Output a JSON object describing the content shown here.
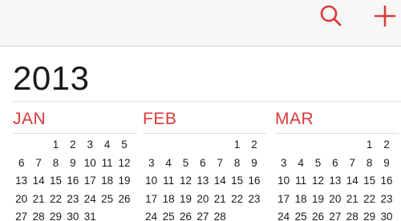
{
  "toolbar": {
    "icons": [
      "search-icon",
      "add-icon"
    ],
    "accent_color": "#d93a3a"
  },
  "year": "2013",
  "months": [
    {
      "name": "JAN",
      "weeks": [
        [
          "",
          "",
          "1",
          "2",
          "3",
          "4",
          "5"
        ],
        [
          "6",
          "7",
          "8",
          "9",
          "10",
          "11",
          "12"
        ],
        [
          "13",
          "14",
          "15",
          "16",
          "17",
          "18",
          "19"
        ],
        [
          "20",
          "21",
          "22",
          "23",
          "24",
          "25",
          "26"
        ],
        [
          "27",
          "28",
          "29",
          "30",
          "31",
          "",
          ""
        ]
      ]
    },
    {
      "name": "FEB",
      "weeks": [
        [
          "",
          "",
          "",
          "",
          "",
          "1",
          "2"
        ],
        [
          "3",
          "4",
          "5",
          "6",
          "7",
          "8",
          "9"
        ],
        [
          "10",
          "11",
          "12",
          "13",
          "14",
          "15",
          "16"
        ],
        [
          "17",
          "18",
          "19",
          "20",
          "21",
          "22",
          "23"
        ],
        [
          "24",
          "25",
          "26",
          "27",
          "28",
          "",
          ""
        ]
      ]
    },
    {
      "name": "MAR",
      "weeks": [
        [
          "",
          "",
          "",
          "",
          "",
          "1",
          "2"
        ],
        [
          "3",
          "4",
          "5",
          "6",
          "7",
          "8",
          "9"
        ],
        [
          "10",
          "11",
          "12",
          "13",
          "14",
          "15",
          "16"
        ],
        [
          "17",
          "18",
          "19",
          "20",
          "21",
          "22",
          "23"
        ],
        [
          "24",
          "25",
          "26",
          "27",
          "28",
          "29",
          "30"
        ]
      ]
    }
  ]
}
